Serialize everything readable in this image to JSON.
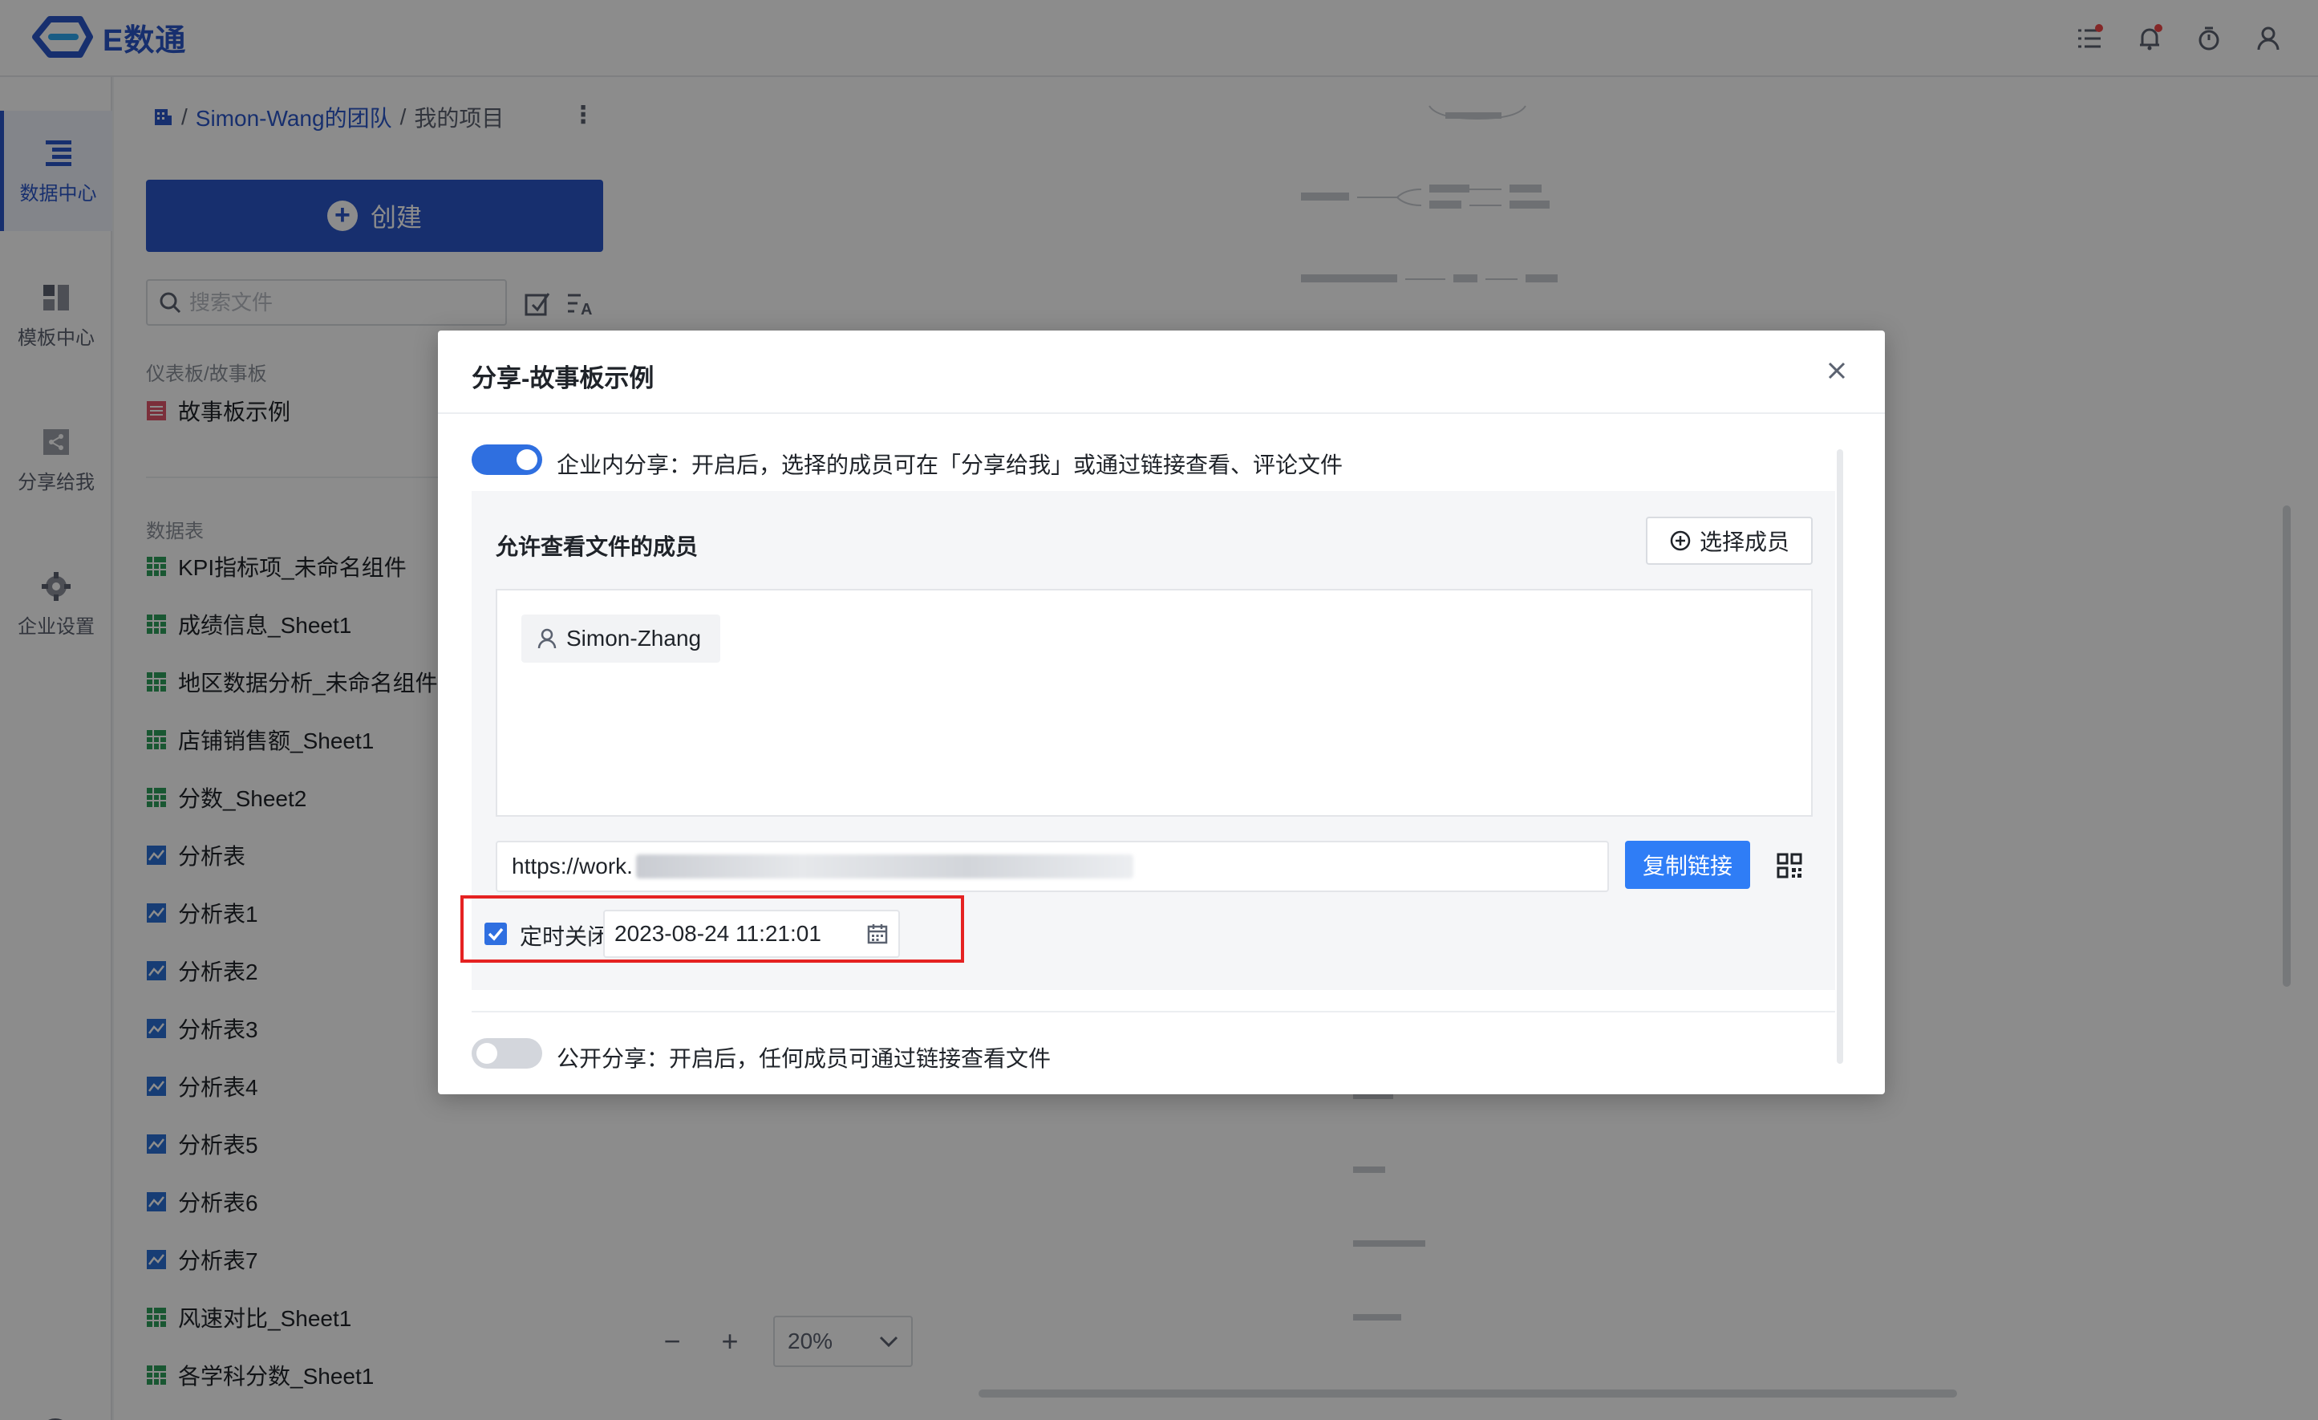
{
  "app": {
    "name": "E数通"
  },
  "leftnav": {
    "items": [
      {
        "label": "数据中心"
      },
      {
        "label": "模板中心"
      },
      {
        "label": "分享给我"
      },
      {
        "label": "企业设置"
      }
    ],
    "help": "?"
  },
  "breadcrumb": {
    "separator": "/",
    "team": "Simon-Wang的团队",
    "current": "我的项目"
  },
  "sidepanel": {
    "create_label": "创建",
    "search_placeholder": "搜索文件",
    "section_dashboards": "仪表板/故事板",
    "dashboards": [
      {
        "name": "故事板示例"
      }
    ],
    "section_tables": "数据表",
    "files": [
      {
        "name": "KPI指标项_未命名组件",
        "type": "table"
      },
      {
        "name": "成绩信息_Sheet1",
        "type": "table"
      },
      {
        "name": "地区数据分析_未命名组件",
        "type": "table"
      },
      {
        "name": "店铺销售额_Sheet1",
        "type": "table"
      },
      {
        "name": "分数_Sheet2",
        "type": "table"
      },
      {
        "name": "分析表",
        "type": "analysis"
      },
      {
        "name": "分析表1",
        "type": "analysis"
      },
      {
        "name": "分析表2",
        "type": "analysis"
      },
      {
        "name": "分析表3",
        "type": "analysis"
      },
      {
        "name": "分析表4",
        "type": "analysis"
      },
      {
        "name": "分析表5",
        "type": "analysis"
      },
      {
        "name": "分析表6",
        "type": "analysis"
      },
      {
        "name": "分析表7",
        "type": "analysis"
      },
      {
        "name": "风速对比_Sheet1",
        "type": "table"
      },
      {
        "name": "各学科分数_Sheet1",
        "type": "table"
      }
    ]
  },
  "canvas": {
    "zoom": "20%"
  },
  "modal": {
    "title": "分享-故事板示例",
    "internal_share": {
      "enabled": true,
      "label": "企业内分享：开启后，选择的成员可在「分享给我」或通过链接查看、评论文件"
    },
    "members_title": "允许查看文件的成员",
    "select_members_label": "选择成员",
    "members": [
      "Simon-Zhang"
    ],
    "link_prefix": "https://work.",
    "copy_link_label": "复制链接",
    "timer": {
      "checked": true,
      "label": "定时关闭",
      "datetime": "2023-08-24 11:21:01"
    },
    "public_share": {
      "enabled": false,
      "label": "公开分享：开启后，任何成员可通过链接查看文件"
    }
  },
  "colors": {
    "brand": "#2b57c9",
    "accent": "#2f7df6",
    "highlight_frame": "#e52222"
  }
}
